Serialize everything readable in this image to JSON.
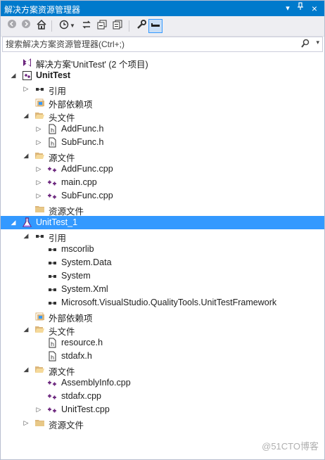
{
  "window": {
    "title": "解决方案资源管理器",
    "pin_glyph": "▾",
    "auto_hide_glyph": "ᵖ",
    "close_glyph": "×"
  },
  "search": {
    "placeholder": "搜索解决方案资源管理器(Ctrl+;)"
  },
  "tree": [
    {
      "depth": 0,
      "expander": "",
      "icon": "solution-icon",
      "label": "解决方案'UnitTest' (2 个项目)",
      "bold": false,
      "selected": false
    },
    {
      "depth": 0,
      "expander": "◢",
      "icon": "cpp-project-icon",
      "label": "UnitTest",
      "bold": true,
      "selected": false
    },
    {
      "depth": 1,
      "expander": "▷",
      "icon": "references-icon",
      "label": "引用",
      "bold": false,
      "selected": false
    },
    {
      "depth": 1,
      "expander": "",
      "icon": "external-deps-icon",
      "label": "外部依赖项",
      "bold": false,
      "selected": false
    },
    {
      "depth": 1,
      "expander": "◢",
      "icon": "folder-open-icon",
      "label": "头文件",
      "bold": false,
      "selected": false
    },
    {
      "depth": 2,
      "expander": "▷",
      "icon": "header-file-icon",
      "label": "AddFunc.h",
      "bold": false,
      "selected": false
    },
    {
      "depth": 2,
      "expander": "▷",
      "icon": "header-file-icon",
      "label": "SubFunc.h",
      "bold": false,
      "selected": false
    },
    {
      "depth": 1,
      "expander": "◢",
      "icon": "folder-open-icon",
      "label": "源文件",
      "bold": false,
      "selected": false
    },
    {
      "depth": 2,
      "expander": "▷",
      "icon": "cpp-file-icon",
      "label": "AddFunc.cpp",
      "bold": false,
      "selected": false
    },
    {
      "depth": 2,
      "expander": "▷",
      "icon": "cpp-file-icon",
      "label": "main.cpp",
      "bold": false,
      "selected": false
    },
    {
      "depth": 2,
      "expander": "▷",
      "icon": "cpp-file-icon",
      "label": "SubFunc.cpp",
      "bold": false,
      "selected": false
    },
    {
      "depth": 1,
      "expander": "",
      "icon": "folder-icon",
      "label": "资源文件",
      "bold": false,
      "selected": false
    },
    {
      "depth": 0,
      "expander": "◢",
      "icon": "test-project-icon",
      "label": "UnitTest_1",
      "bold": false,
      "selected": true
    },
    {
      "depth": 1,
      "expander": "◢",
      "icon": "references-icon",
      "label": "引用",
      "bold": false,
      "selected": false
    },
    {
      "depth": 2,
      "expander": "",
      "icon": "assembly-ref-icon",
      "label": "mscorlib",
      "bold": false,
      "selected": false
    },
    {
      "depth": 2,
      "expander": "",
      "icon": "assembly-ref-icon",
      "label": "System.Data",
      "bold": false,
      "selected": false
    },
    {
      "depth": 2,
      "expander": "",
      "icon": "assembly-ref-icon",
      "label": "System",
      "bold": false,
      "selected": false
    },
    {
      "depth": 2,
      "expander": "",
      "icon": "assembly-ref-icon",
      "label": "System.Xml",
      "bold": false,
      "selected": false
    },
    {
      "depth": 2,
      "expander": "",
      "icon": "assembly-ref-icon",
      "label": "Microsoft.VisualStudio.QualityTools.UnitTestFramework",
      "bold": false,
      "selected": false
    },
    {
      "depth": 1,
      "expander": "",
      "icon": "external-deps-icon",
      "label": "外部依赖项",
      "bold": false,
      "selected": false
    },
    {
      "depth": 1,
      "expander": "◢",
      "icon": "folder-open-icon",
      "label": "头文件",
      "bold": false,
      "selected": false
    },
    {
      "depth": 2,
      "expander": "",
      "icon": "header-file-icon",
      "label": "resource.h",
      "bold": false,
      "selected": false
    },
    {
      "depth": 2,
      "expander": "",
      "icon": "header-file-icon",
      "label": "stdafx.h",
      "bold": false,
      "selected": false
    },
    {
      "depth": 1,
      "expander": "◢",
      "icon": "folder-open-icon",
      "label": "源文件",
      "bold": false,
      "selected": false
    },
    {
      "depth": 2,
      "expander": "",
      "icon": "cpp-file-icon",
      "label": "AssemblyInfo.cpp",
      "bold": false,
      "selected": false
    },
    {
      "depth": 2,
      "expander": "",
      "icon": "cpp-file-icon",
      "label": "stdafx.cpp",
      "bold": false,
      "selected": false
    },
    {
      "depth": 2,
      "expander": "▷",
      "icon": "cpp-file-icon",
      "label": "UnitTest.cpp",
      "bold": false,
      "selected": false
    },
    {
      "depth": 1,
      "expander": "▷",
      "icon": "folder-icon",
      "label": "资源文件",
      "bold": false,
      "selected": false
    }
  ],
  "watermark": "@51CTO博客",
  "colors": {
    "accent": "#007acc",
    "selection": "#3399ff",
    "folder": "#dcb67a"
  }
}
